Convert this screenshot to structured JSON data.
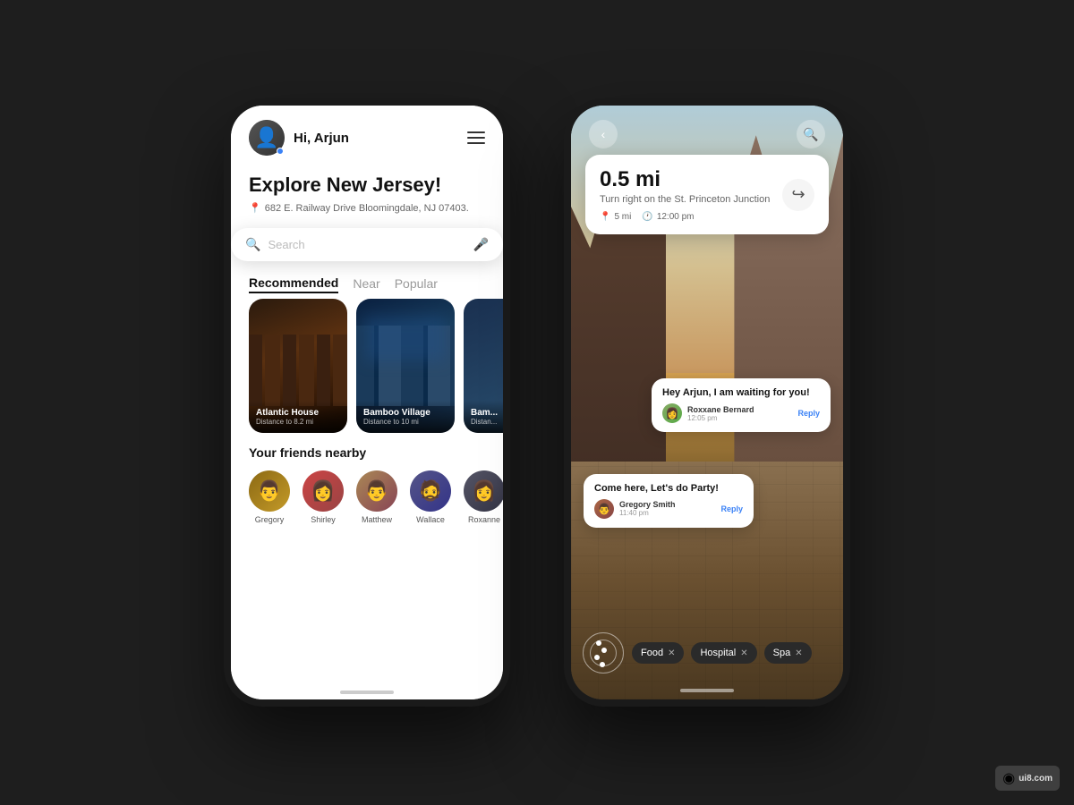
{
  "background_color": "#1e1e1e",
  "left_phone": {
    "header": {
      "greeting": "Hi, Arjun",
      "avatar_emoji": "👤"
    },
    "explore": {
      "title": "Explore New Jersey!",
      "location": "682 E. Railway Drive Bloomingdale, NJ 07403."
    },
    "search": {
      "placeholder": "Search"
    },
    "tabs": [
      {
        "label": "Recommended",
        "active": true
      },
      {
        "label": "Near",
        "active": false
      },
      {
        "label": "Popular",
        "active": false
      }
    ],
    "cards": [
      {
        "name": "Atlantic House",
        "distance": "Distance to 8.2 mi"
      },
      {
        "name": "Bamboo Village",
        "distance": "Distance to 10 mi"
      },
      {
        "name": "Bam...",
        "distance": "Distan..."
      }
    ],
    "friends_section": {
      "title": "Your friends nearby",
      "friends": [
        {
          "name": "Gregory",
          "emoji": "👨"
        },
        {
          "name": "Shirley",
          "emoji": "👩"
        },
        {
          "name": "Matthew",
          "emoji": "👨"
        },
        {
          "name": "Wallace",
          "emoji": "🧔"
        },
        {
          "name": "Roxanne",
          "emoji": "👩"
        }
      ]
    }
  },
  "right_phone": {
    "navigation": {
      "distance": "0.5 mi",
      "instruction": "Turn right on the St. Princeton Junction",
      "total_distance": "5 mi",
      "eta": "12:00 pm"
    },
    "messages": [
      {
        "text": "Hey Arjun, I am waiting for you!",
        "sender": "Roxxane Bernard",
        "time": "12:05 pm",
        "reply_label": "Reply"
      },
      {
        "text": "Come here, Let's do Party!",
        "sender": "Gregory Smith",
        "time": "11:40 pm",
        "reply_label": "Reply"
      }
    ],
    "filters": [
      {
        "label": "Food"
      },
      {
        "label": "Hospital"
      },
      {
        "label": "Spa"
      }
    ]
  },
  "watermark": {
    "symbol": "◉",
    "text": "ui8.com"
  }
}
